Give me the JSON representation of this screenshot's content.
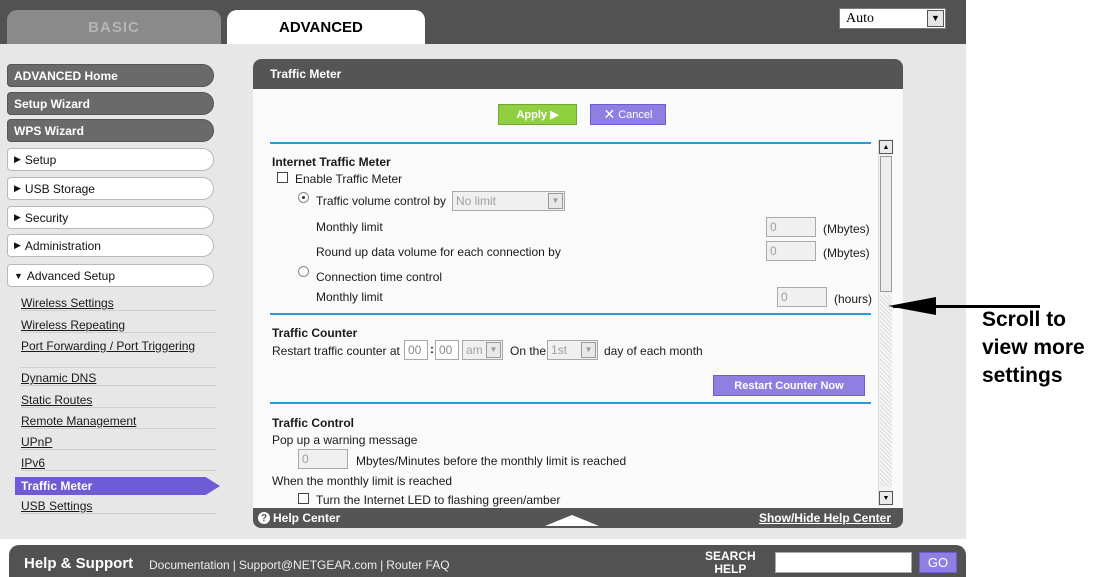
{
  "tabs": {
    "basic": "BASIC",
    "advanced": "ADVANCED"
  },
  "language_select": {
    "value": "Auto"
  },
  "nav": {
    "top_items": [
      "ADVANCED Home",
      "Setup Wizard",
      "WPS Wizard"
    ],
    "groups": [
      "Setup",
      "USB Storage",
      "Security",
      "Administration",
      "Advanced Setup"
    ],
    "sub_items": [
      "Wireless Settings",
      "Wireless Repeating",
      "Port Forwarding / Port Triggering",
      "Dynamic DNS",
      "Static Routes",
      "Remote Management",
      "UPnP",
      "IPv6",
      "Traffic Meter",
      "USB Settings"
    ],
    "active": "Traffic Meter"
  },
  "panel": {
    "title": "Traffic Meter",
    "apply_label": "Apply ▶",
    "cancel_label": "Cancel"
  },
  "internet_traffic_meter": {
    "title": "Internet Traffic Meter",
    "enable_label": "Enable Traffic Meter",
    "volume_control_label": "Traffic volume control by",
    "volume_control_value": "No limit",
    "monthly_limit_label": "Monthly limit",
    "monthly_limit_value": "0",
    "monthly_limit_unit": "(Mbytes)",
    "round_up_label": "Round up data volume for each connection by",
    "round_up_value": "0",
    "round_up_unit": "(Mbytes)",
    "time_control_label": "Connection time control",
    "time_limit_label": "Monthly limit",
    "time_limit_value": "0",
    "time_limit_unit": "(hours)"
  },
  "traffic_counter": {
    "title": "Traffic Counter",
    "restart_label": "Restart traffic counter at",
    "hour": "00",
    "minute": "00",
    "ampm": "am",
    "on_the_label": "On the",
    "day": "1st",
    "day_suffix": "day of each month",
    "restart_now_label": "Restart Counter Now"
  },
  "traffic_control": {
    "title": "Traffic Control",
    "popup_label": "Pop up a warning message",
    "warning_value": "0",
    "warning_suffix": "Mbytes/Minutes before the monthly limit is reached",
    "when_reached_label": "When the monthly limit is reached",
    "led_label": "Turn the Internet LED to flashing green/amber"
  },
  "panel_footer": {
    "help_center": "Help Center",
    "show_hide": "Show/Hide Help Center"
  },
  "bottom_bar": {
    "title": "Help & Support",
    "links": [
      "Documentation",
      "Support@NETGEAR.com",
      "Router FAQ"
    ],
    "search_label_1": "SEARCH",
    "search_label_2": "HELP",
    "go_label": "GO"
  },
  "callout": {
    "line1": "Scroll to",
    "line2": "view more",
    "line3": "settings"
  }
}
